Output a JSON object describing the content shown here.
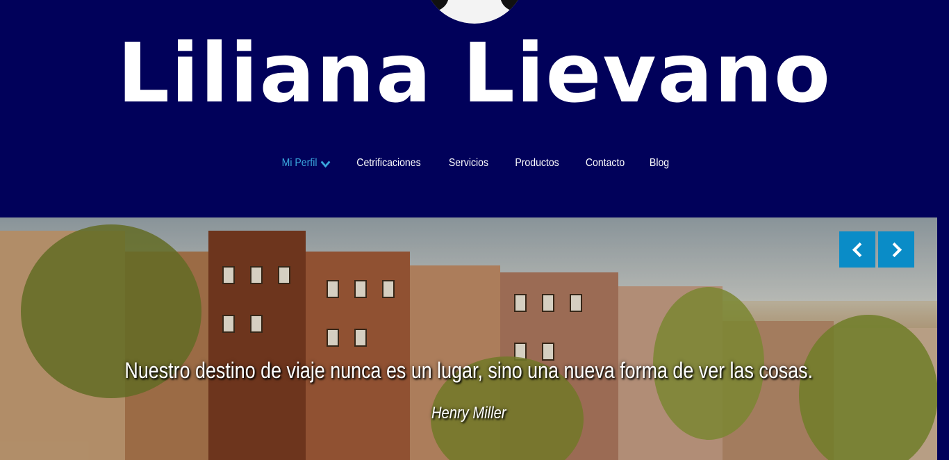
{
  "site": {
    "title": "Liliana Lievano"
  },
  "nav": {
    "items": [
      {
        "label": "Mi Perfil",
        "active": true,
        "has_dropdown": true
      },
      {
        "label": "Cetrificaciones"
      },
      {
        "label": "Servicios"
      },
      {
        "label": "Productos"
      },
      {
        "label": "Contacto"
      },
      {
        "label": "Blog"
      }
    ]
  },
  "slider": {
    "quote": "Nuestro destino de viaje nunca es un lugar, sino una nueva forma de ver las cosas.",
    "author": "Henry Miller",
    "prev_icon": "chevron-left-icon",
    "next_icon": "chevron-right-icon"
  },
  "colors": {
    "background": "#01015a",
    "accent": "#3aa7dd",
    "button": "#0a8cc7"
  }
}
